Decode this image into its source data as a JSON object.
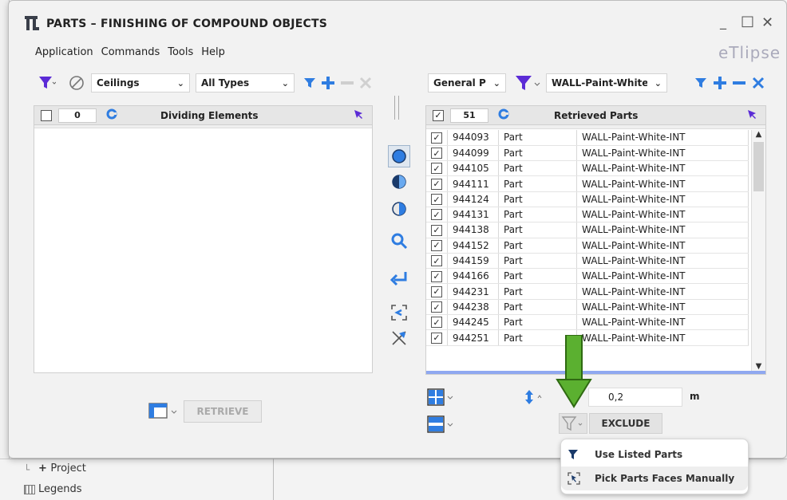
{
  "window": {
    "title": "PARTS – FINISHING OF COMPOUND OBJECTS",
    "brand": "eTlipse",
    "minimize": "_",
    "maximize": "□",
    "close": "✕"
  },
  "menu": [
    "Application",
    "Commands",
    "Tools",
    "Help"
  ],
  "left": {
    "category": "Ceilings",
    "types": "All Types",
    "count": "0",
    "header": "Dividing Elements",
    "retrieve_label": "RETRIEVE"
  },
  "right": {
    "param": "General P",
    "value_filter": "WALL-Paint-White-INT",
    "count": "51",
    "header": "Retrieved Parts",
    "rows": [
      {
        "id": "944093",
        "type": "Part",
        "name": "WALL-Paint-White-INT"
      },
      {
        "id": "944099",
        "type": "Part",
        "name": "WALL-Paint-White-INT"
      },
      {
        "id": "944105",
        "type": "Part",
        "name": "WALL-Paint-White-INT"
      },
      {
        "id": "944111",
        "type": "Part",
        "name": "WALL-Paint-White-INT"
      },
      {
        "id": "944124",
        "type": "Part",
        "name": "WALL-Paint-White-INT"
      },
      {
        "id": "944131",
        "type": "Part",
        "name": "WALL-Paint-White-INT"
      },
      {
        "id": "944138",
        "type": "Part",
        "name": "WALL-Paint-White-INT"
      },
      {
        "id": "944152",
        "type": "Part",
        "name": "WALL-Paint-White-INT"
      },
      {
        "id": "944159",
        "type": "Part",
        "name": "WALL-Paint-White-INT"
      },
      {
        "id": "944166",
        "type": "Part",
        "name": "WALL-Paint-White-INT"
      },
      {
        "id": "944231",
        "type": "Part",
        "name": "WALL-Paint-White-INT"
      },
      {
        "id": "944238",
        "type": "Part",
        "name": "WALL-Paint-White-INT"
      },
      {
        "id": "944245",
        "type": "Part",
        "name": "WALL-Paint-White-INT"
      },
      {
        "id": "944251",
        "type": "Part",
        "name": "WALL-Paint-White-INT"
      }
    ],
    "offset_value": "0,2",
    "offset_unit": "m",
    "exclude_label": "EXCLUDE"
  },
  "dropdown": {
    "items": [
      "Use Listed Parts",
      "Pick Parts Faces Manually"
    ]
  },
  "background": {
    "project": "Project",
    "legends": "Legends"
  },
  "colors": {
    "accent_blue": "#2f7de1",
    "filter_purple": "#5b2bd6",
    "arrow_green": "#5bb030"
  }
}
